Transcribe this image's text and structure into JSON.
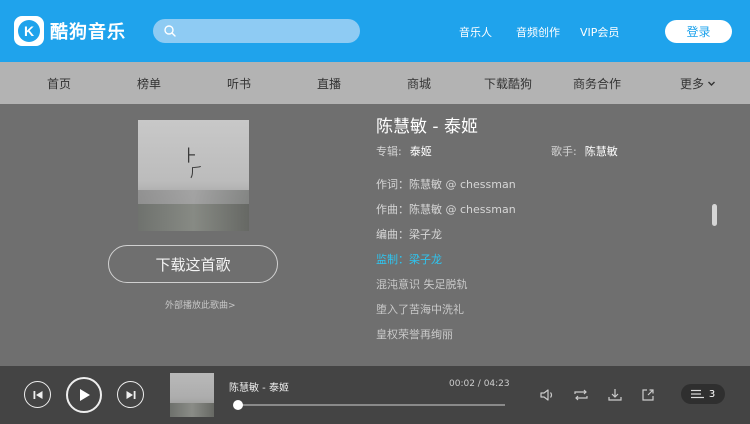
{
  "header": {
    "brand": "酷狗音乐",
    "logo_letter": "K",
    "search": {
      "placeholder": ""
    },
    "links": [
      "音乐人",
      "音频创作",
      "VIP会员"
    ],
    "login_label": "登录"
  },
  "nav": {
    "items": [
      "首页",
      "榜单",
      "听书",
      "直播",
      "商城",
      "下载酷狗",
      "商务合作",
      "更多"
    ]
  },
  "song": {
    "title": "陈慧敏 - 泰姬",
    "album_label": "专辑:",
    "album": "泰姬",
    "singer_label": "歌手:",
    "singer": "陈慧敏",
    "download_label": "下载这首歌",
    "external_play_label": "外部播放此歌曲>",
    "lyrics": [
      "作词：陈慧敏 @ chessman",
      "作曲：陈慧敏 @ chessman",
      "编曲：梁子龙",
      "监制：梁子龙",
      "混沌意识 失足脱轨",
      "堕入了苦海中洗礼",
      "皇权荣誉再绚丽"
    ],
    "active_lyric_index": 3
  },
  "player": {
    "now_playing": "陈慧敏 - 泰姬",
    "current_time": "00:02",
    "total_time": "04:23",
    "time_display": "00:02 / 04:23",
    "progress_fraction": 0.008,
    "queue_count": "3",
    "icons": [
      "prev-icon",
      "play-icon",
      "next-icon",
      "volume-icon",
      "repeat-icon",
      "download-icon",
      "share-icon",
      "playlist-icon"
    ]
  },
  "colors": {
    "brand_blue": "#1fa3ec",
    "active_lyric": "#2ec5f0"
  }
}
